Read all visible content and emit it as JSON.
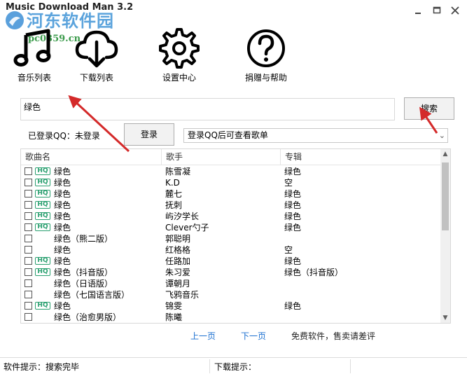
{
  "window": {
    "title": "Music Download Man 3.2"
  },
  "watermark": {
    "text": "河东软件园",
    "url": "pc0359.cn"
  },
  "nav": [
    {
      "label": "音乐列表",
      "icon": "music-note-icon"
    },
    {
      "label": "下载列表",
      "icon": "cloud-download-icon"
    },
    {
      "label": "设置中心",
      "icon": "gear-icon"
    },
    {
      "label": "捐赠与帮助",
      "icon": "question-icon"
    }
  ],
  "search": {
    "value": "绿色",
    "button_label": "搜索"
  },
  "login": {
    "status": "已登录QQ：未登录",
    "button_label": "登录",
    "select_value": "登录QQ后可查看歌单"
  },
  "table": {
    "columns": [
      "歌曲名",
      "歌手",
      "专辑"
    ],
    "rows": [
      {
        "hq": true,
        "song": "绿色",
        "artist": "陈雪凝",
        "album": "绿色"
      },
      {
        "hq": true,
        "song": "绿色",
        "artist": "K.D",
        "album": "空"
      },
      {
        "hq": true,
        "song": "绿色",
        "artist": "麓七",
        "album": "绿色"
      },
      {
        "hq": true,
        "song": "绿色",
        "artist": "抚刺",
        "album": "绿色"
      },
      {
        "hq": true,
        "song": "绿色",
        "artist": "屿汐学长",
        "album": "绿色"
      },
      {
        "hq": true,
        "song": "绿色",
        "artist": "Clever勺子",
        "album": "绿色"
      },
      {
        "hq": false,
        "song": "绿色（熊二版）",
        "artist": "郭聪明",
        "album": ""
      },
      {
        "hq": false,
        "song": "绿色",
        "artist": "红格格",
        "album": "空"
      },
      {
        "hq": true,
        "song": "绿色",
        "artist": "任路加",
        "album": "绿色"
      },
      {
        "hq": true,
        "song": "绿色（抖音版）",
        "artist": "朱习爱",
        "album": "绿色（抖音版）"
      },
      {
        "hq": false,
        "song": "绿色（日语版）",
        "artist": "谭朝月",
        "album": ""
      },
      {
        "hq": false,
        "song": "绿色（七国语言版）",
        "artist": "飞鸦音乐",
        "album": ""
      },
      {
        "hq": true,
        "song": "绿色",
        "artist": "锦雯",
        "album": "绿色"
      },
      {
        "hq": false,
        "song": "绿色（治愈男版）",
        "artist": "陈曦",
        "album": ""
      }
    ]
  },
  "pagination": {
    "prev": "上一页",
    "next": "下一页",
    "note": "免费软件，售卖请差评"
  },
  "statusbar": {
    "software_tip": "软件提示：搜索完毕",
    "download_tip": "下载提示："
  },
  "hq_badge": "HQ",
  "colors": {
    "accent_link": "#1a6fd0",
    "hq_badge": "#2aa070",
    "arrow": "#d42a2a"
  }
}
